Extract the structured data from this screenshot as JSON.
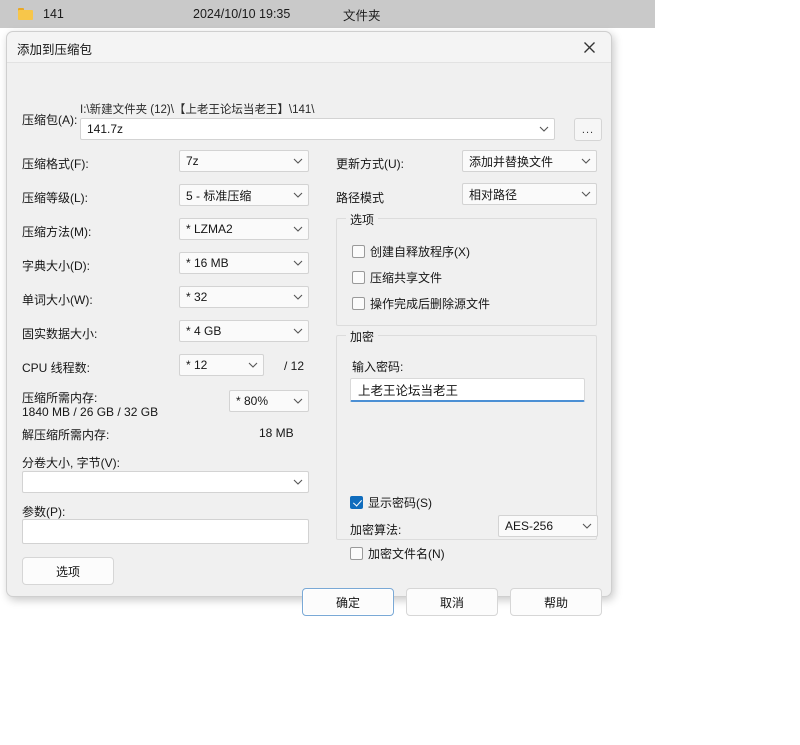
{
  "explorer": {
    "folder_icon": "folder-icon",
    "name": "141",
    "date": "2024/10/10 19:35",
    "type": "文件夹"
  },
  "dialog": {
    "title": "添加到压缩包",
    "close_icon": "close-icon"
  },
  "archive": {
    "label": "压缩包(A):",
    "path": "I:\\新建文件夹 (12)\\【上老王论坛当老王】\\141\\",
    "value": "141.7z",
    "browse_label": "..."
  },
  "left_fields": {
    "format_label": "压缩格式(F):",
    "format_value": "7z",
    "level_label": "压缩等级(L):",
    "level_value": "5 - 标准压缩",
    "method_label": "压缩方法(M):",
    "method_value": "* LZMA2",
    "dict_label": "字典大小(D):",
    "dict_value": "* 16 MB",
    "word_label": "单词大小(W):",
    "word_value": "* 32",
    "solid_label": "固实数据大小:",
    "solid_value": "* 4 GB",
    "cpu_label": "CPU 线程数:",
    "cpu_value": "* 12",
    "cpu_total": "/ 12",
    "mem_compress_label": "压缩所需内存:",
    "mem_compress_detail": "1840 MB / 26 GB / 32 GB",
    "mem_percent_value": "* 80%",
    "mem_extract_label": "解压缩所需内存:",
    "mem_extract_value": "18 MB",
    "split_label": "分卷大小, 字节(V):",
    "split_value": "",
    "params_label": "参数(P):",
    "params_value": ""
  },
  "right_fields": {
    "update_label": "更新方式(U):",
    "update_value": "添加并替换文件",
    "path_mode_label": "路径模式",
    "path_mode_value": "相对路径"
  },
  "options_group": {
    "title": "选项",
    "items": [
      {
        "label": "创建自释放程序(X)",
        "checked": false
      },
      {
        "label": "压缩共享文件",
        "checked": false
      },
      {
        "label": "操作完成后删除源文件",
        "checked": false
      }
    ]
  },
  "encryption_group": {
    "title": "加密",
    "password_label": "输入密码:",
    "password_value": "上老王论坛当老王",
    "show_password_label": "显示密码(S)",
    "show_password_checked": true,
    "algorithm_label": "加密算法:",
    "algorithm_value": "AES-256",
    "encrypt_names_label": "加密文件名(N)",
    "encrypt_names_checked": false
  },
  "buttons": {
    "options": "选项",
    "ok": "确定",
    "cancel": "取消",
    "help": "帮助"
  },
  "colors": {
    "accent": "#0f6cbd",
    "focus_border": "#4b8fd4",
    "dialog_bg": "#f0f0f0",
    "explorer_bg": "#c9c9c9",
    "folder": "#f7c64a"
  }
}
